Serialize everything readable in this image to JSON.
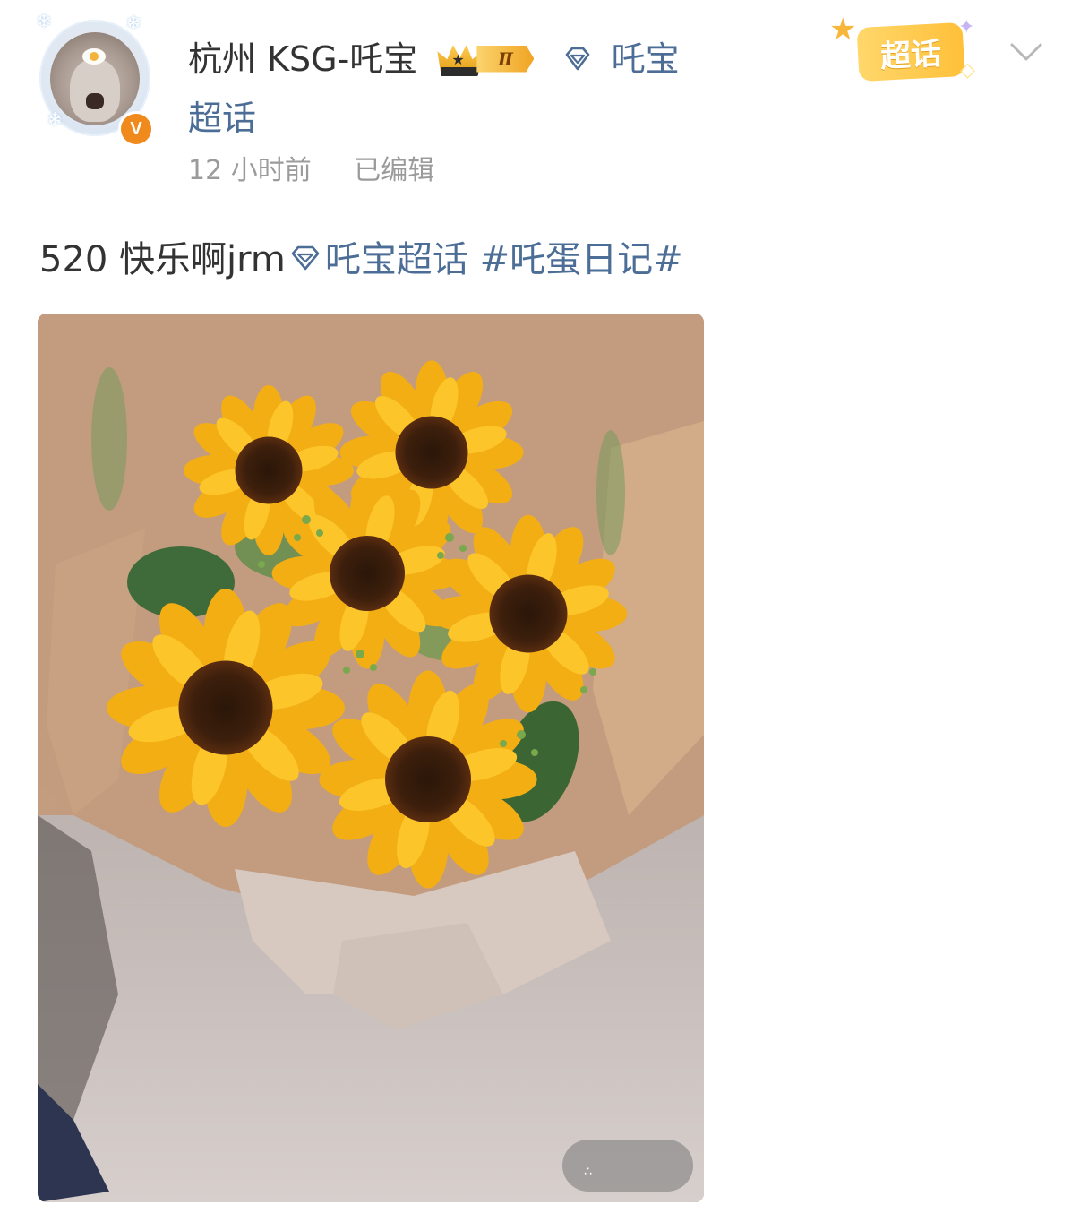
{
  "post": {
    "username": "杭州 KSG-吒宝",
    "level_badge": "Ⅱ",
    "topic_inline": "吒宝",
    "topic_inline_cont": "超话",
    "time": "12 小时前",
    "edited": "已编辑",
    "supertopic_badge": "超话",
    "text_prefix": "520 快乐啊jrm",
    "text_topic": "吒宝超话",
    "text_hashtag": "#吒蛋日记#",
    "verified_mark": "V"
  },
  "icons": {
    "diamond": "diamond-icon",
    "crown": "crown-icon",
    "chevron": "chevron-down-icon",
    "verified": "verified-icon"
  },
  "colors": {
    "link": "#4b6d96",
    "text": "#333333",
    "meta": "#9b9b9b",
    "verified": "#f08a1c",
    "badge": "#ffc03a"
  }
}
